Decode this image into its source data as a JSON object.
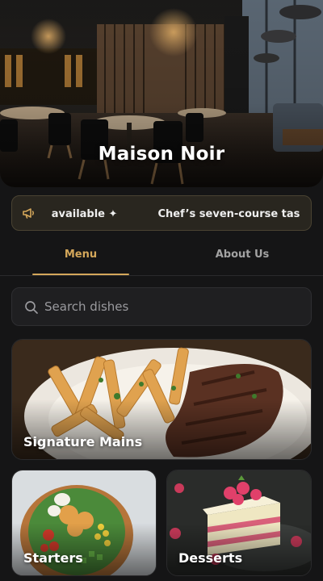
{
  "restaurant": {
    "name": "Maison Noir"
  },
  "announcement": {
    "icon": "megaphone-icon",
    "messages": [
      " now available ✦",
      "Chef’s seven-course tas"
    ]
  },
  "tabs": [
    {
      "label": "Menu",
      "active": true
    },
    {
      "label": "About Us",
      "active": false
    }
  ],
  "search": {
    "placeholder": "Search dishes",
    "value": ""
  },
  "categories": [
    {
      "label": "Signature Mains"
    },
    {
      "label": "Starters"
    },
    {
      "label": "Desserts"
    }
  ],
  "colors": {
    "accent": "#d4a75a",
    "background": "#151516",
    "announce_bg": "#29261f"
  }
}
